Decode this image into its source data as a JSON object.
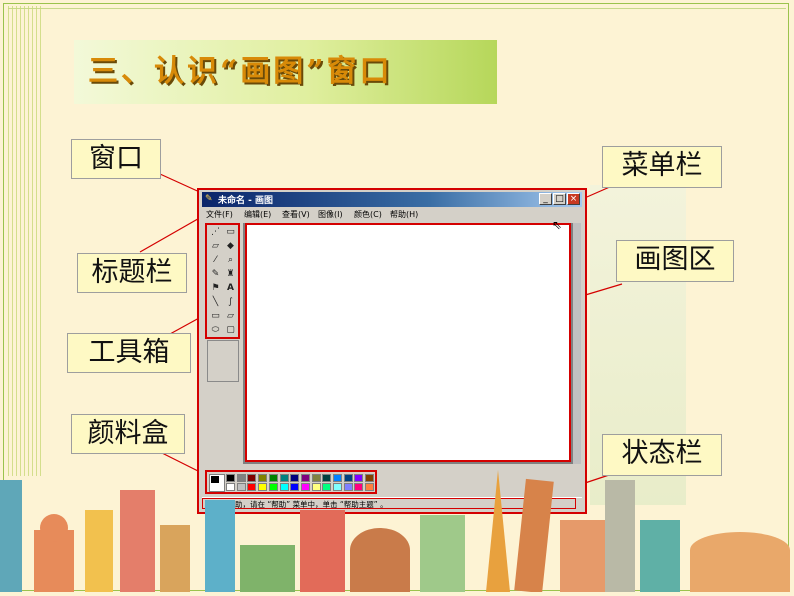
{
  "slide": {
    "title": "三、认识“画图”窗口"
  },
  "labels": {
    "window": "窗口",
    "title_bar": "标题栏",
    "toolbox": "工具箱",
    "palette": "颜料盒",
    "menu_bar": "菜单栏",
    "drawing_area": "画图区",
    "status_bar": "状态栏"
  },
  "paint": {
    "window_title": "未命名 - 画图",
    "menus": [
      "文件(F)",
      "编辑(E)",
      "查看(V)",
      "图像(I)",
      "颜色(C)",
      "帮助(H)"
    ],
    "status_text": "要获得帮助，请在 “帮助” 菜单中，单击 “帮助主题” 。",
    "palette_row1": [
      "#000000",
      "#808080",
      "#800000",
      "#808000",
      "#008000",
      "#008080",
      "#000080",
      "#800080",
      "#808040",
      "#004040",
      "#0080ff",
      "#004080",
      "#8000ff",
      "#804000"
    ],
    "palette_row2": [
      "#ffffff",
      "#c0c0c0",
      "#ff0000",
      "#ffff00",
      "#00ff00",
      "#00ffff",
      "#0000ff",
      "#ff00ff",
      "#ffff80",
      "#00ff80",
      "#80ffff",
      "#8080ff",
      "#ff0080",
      "#ff8040"
    ]
  },
  "colors": {
    "accent_red": "#d40000",
    "title_orange": "#d88a08",
    "label_bg": "#fef9c4"
  }
}
